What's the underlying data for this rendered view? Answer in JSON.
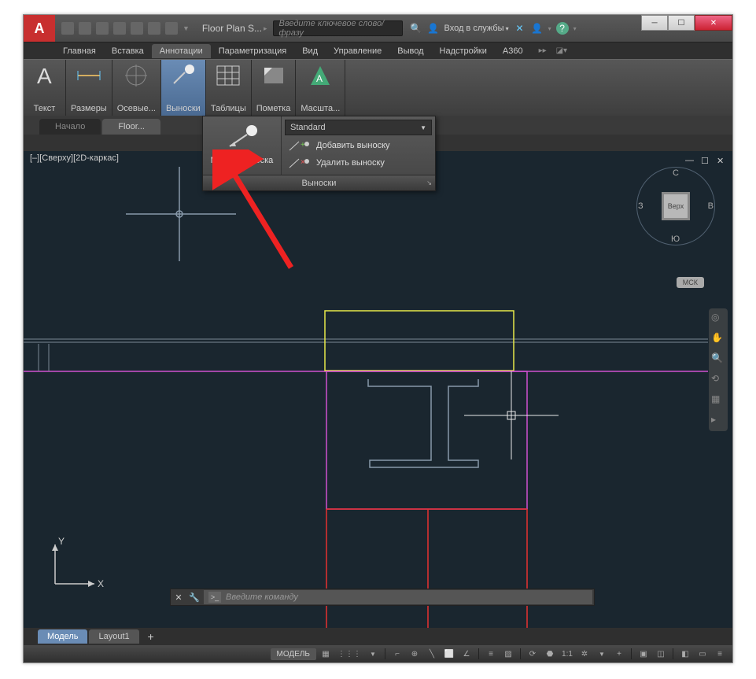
{
  "title": "Floor Plan S...",
  "search_placeholder": "Введите ключевое слово/фразу",
  "login_text": "Вход в службы",
  "ribbon_tabs": [
    "Главная",
    "Вставка",
    "Аннотации",
    "Параметризация",
    "Вид",
    "Управление",
    "Вывод",
    "Надстройки",
    "A360"
  ],
  "active_ribbon_tab": 2,
  "panels": {
    "text": "Текст",
    "dimensions": "Размеры",
    "axes": "Осевые...",
    "leaders": "Выноски",
    "tables": "Таблицы",
    "markup": "Пометка",
    "scale": "Масшта..."
  },
  "file_tabs": {
    "start": "Начало",
    "active": "Floor..."
  },
  "popup": {
    "multileader": "Мультивыноска",
    "standard": "Standard",
    "add": "Добавить выноску",
    "remove": "Удалить выноску",
    "footer": "Выноски"
  },
  "view_label": "[–][Сверху][2D-каркас]",
  "viewcube": {
    "top": "Верх",
    "n": "С",
    "s": "Ю",
    "e": "В",
    "w": "З"
  },
  "ucs_label": "МСК",
  "cmd_placeholder": "Введите команду",
  "layout_tabs": {
    "model": "Модель",
    "layout1": "Layout1"
  },
  "status": {
    "model": "МОДЕЛЬ",
    "scale": "1:1"
  },
  "axes": {
    "x": "X",
    "y": "Y"
  }
}
